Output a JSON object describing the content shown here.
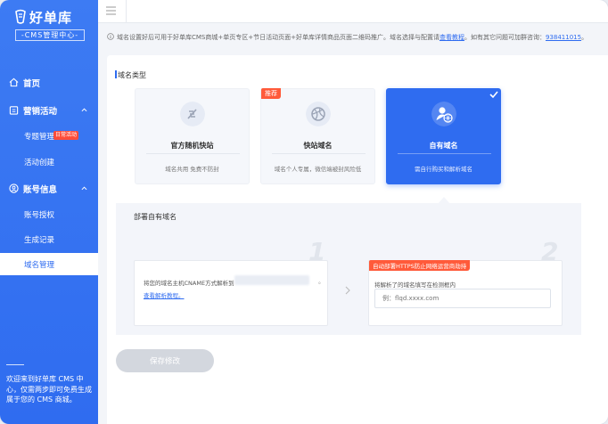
{
  "brand": {
    "name": "好单库",
    "subtitle": "-CMS管理中心-"
  },
  "sidebar": {
    "items": [
      {
        "label": "首页"
      },
      {
        "label": "营销活动"
      },
      {
        "label": "专题管理",
        "badge": "日常活动"
      },
      {
        "label": "活动创建"
      },
      {
        "label": "账号信息"
      },
      {
        "label": "账号授权"
      },
      {
        "label": "生成记录"
      },
      {
        "label": "域名管理"
      }
    ],
    "note": "欢迎来到好单库 CMS 中心，仅需两步即可免费生成属于您的 CMS 商城。"
  },
  "notice": {
    "text": "域名设置好后可用于好单库CMS商城+单页专区+节日活动页面+好单库详情商品页面二维码推广。域名选择与配置请",
    "link": "查看教程",
    "tail": "。如有其它问题可加群咨询：",
    "group": "938411015",
    "end": "。"
  },
  "domain_type": {
    "label": "域名类型",
    "options": [
      {
        "title": "官方随机快站",
        "desc": "域名共用 免费不防封",
        "icon": "feather-icon"
      },
      {
        "title": "快站域名",
        "desc": "域名个人专属，微信端被封风险低",
        "tag": "推荐",
        "icon": "volleyball-icon"
      },
      {
        "title": "自有域名",
        "desc": "需自行购买和解析域名",
        "icon": "user-globe-icon",
        "selected": true
      }
    ]
  },
  "deploy": {
    "title": "部署自有域名",
    "step1": {
      "number": "1",
      "text": "将您的域名主机CNAME方式解析到",
      "dot": "。",
      "link": "查看解析教程。"
    },
    "step2": {
      "number": "2",
      "tag": "自动部署HTTPS防止网络运营商劫持",
      "text": "将解析了的域名填写在检测框内",
      "placeholder": "例：flqd.xxxx.com"
    }
  },
  "actions": {
    "save_label": "保存修改"
  },
  "colors": {
    "primary": "#2f6cf0",
    "tag": "#ff5a3a",
    "disabled": "#d3d7de"
  }
}
